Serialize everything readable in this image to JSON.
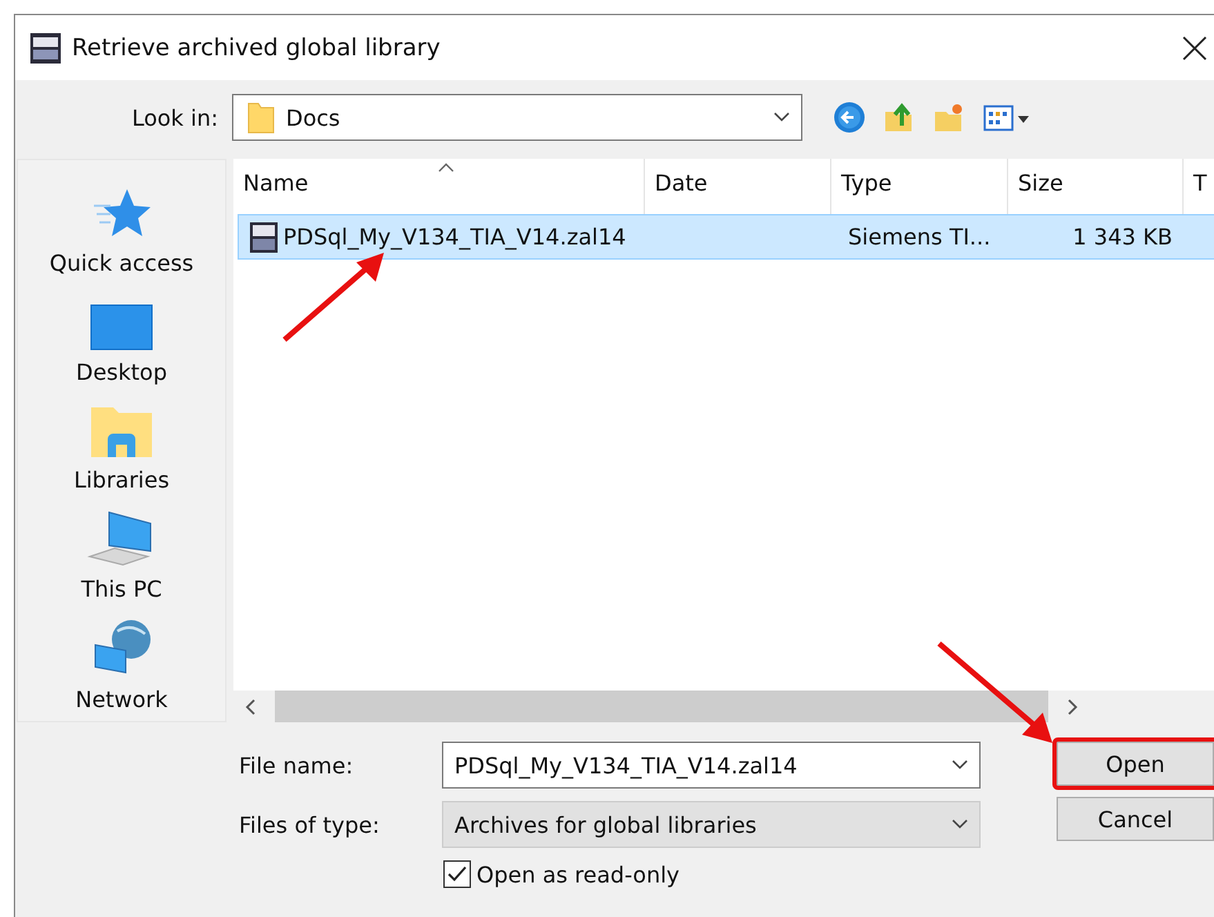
{
  "window": {
    "title": "Retrieve archived global library"
  },
  "look_in": {
    "label": "Look in:",
    "value": "Docs"
  },
  "sidebar": {
    "items": [
      {
        "label": "Quick access",
        "kind": "star"
      },
      {
        "label": "Desktop",
        "kind": "desktop"
      },
      {
        "label": "Libraries",
        "kind": "libraries"
      },
      {
        "label": "This PC",
        "kind": "pc"
      },
      {
        "label": "Network",
        "kind": "network"
      }
    ]
  },
  "file_list": {
    "columns": [
      "Name",
      "Date",
      "Type",
      "Size",
      "T"
    ],
    "rows": [
      {
        "cells": [
          "PDSql_My_V134_TIA_V14.zal14",
          "",
          "Siemens TI...",
          "1 343 KB",
          ""
        ],
        "selected": true
      }
    ]
  },
  "file_name": {
    "label": "File name:",
    "value": "PDSql_My_V134_TIA_V14.zal14"
  },
  "file_type": {
    "label": "Files of type:",
    "value": "Archives for global libraries"
  },
  "read_only": {
    "label": "Open as read-only",
    "checked": true
  },
  "buttons": [
    {
      "label": "Open",
      "highlighted": true
    },
    {
      "label": "Cancel",
      "highlighted": false
    }
  ]
}
